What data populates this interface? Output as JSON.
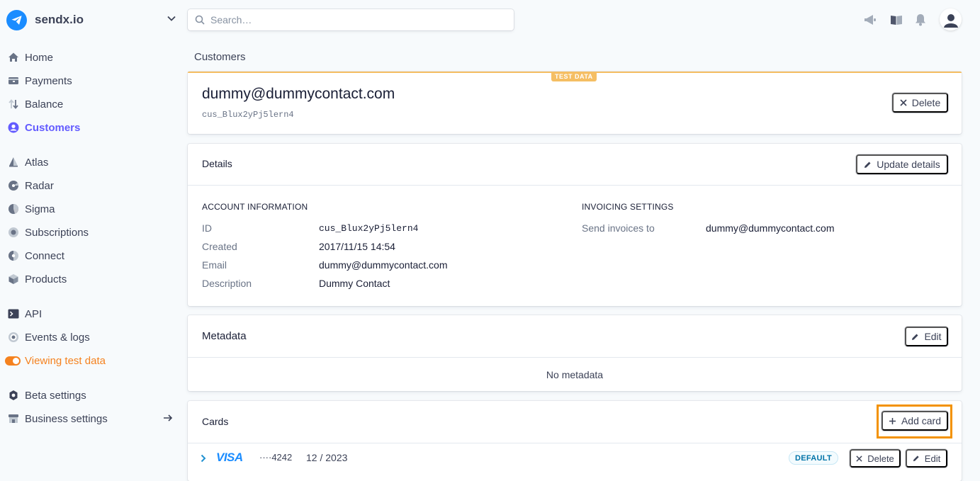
{
  "brand": {
    "name": "sendx.io"
  },
  "search": {
    "placeholder": "Search…"
  },
  "sidebar": {
    "items": [
      {
        "label": "Home"
      },
      {
        "label": "Payments"
      },
      {
        "label": "Balance"
      },
      {
        "label": "Customers"
      },
      {
        "label": "Atlas"
      },
      {
        "label": "Radar"
      },
      {
        "label": "Sigma"
      },
      {
        "label": "Subscriptions"
      },
      {
        "label": "Connect"
      },
      {
        "label": "Products"
      },
      {
        "label": "API"
      },
      {
        "label": "Events & logs"
      },
      {
        "label": "Viewing test data"
      },
      {
        "label": "Beta settings"
      },
      {
        "label": "Business settings"
      }
    ]
  },
  "breadcrumb": "Customers",
  "customer": {
    "test_badge": "TEST DATA",
    "email": "dummy@dummycontact.com",
    "id": "cus_Blux2yPj5lern4",
    "delete_label": "Delete"
  },
  "details": {
    "title": "Details",
    "update_label": "Update details",
    "account_heading": "ACCOUNT INFORMATION",
    "invoicing_heading": "INVOICING SETTINGS",
    "rows": [
      {
        "label": "ID",
        "value": "cus_Blux2yPj5lern4"
      },
      {
        "label": "Created",
        "value": "2017/11/15 14:54"
      },
      {
        "label": "Email",
        "value": "dummy@dummycontact.com"
      },
      {
        "label": "Description",
        "value": "Dummy Contact"
      }
    ],
    "invoicing": {
      "label": "Send invoices to",
      "value": "dummy@dummycontact.com"
    }
  },
  "metadata": {
    "title": "Metadata",
    "edit_label": "Edit",
    "empty": "No metadata"
  },
  "cards": {
    "title": "Cards",
    "add_label": "Add card",
    "rows": [
      {
        "brand": "VISA",
        "last4": "····4242",
        "expiry": "12 / 2023",
        "badge": "DEFAULT",
        "delete_label": "Delete",
        "edit_label": "Edit"
      }
    ]
  },
  "colors": {
    "accent": "#635bff",
    "test_orange": "#f5821f",
    "test_badge": "#f5be63",
    "highlight": "#f39200",
    "visa_blue": "#1a1f71"
  },
  "icons": {
    "top": [
      "megaphone-icon",
      "book-icon",
      "bell-icon",
      "user-avatar-icon"
    ]
  }
}
